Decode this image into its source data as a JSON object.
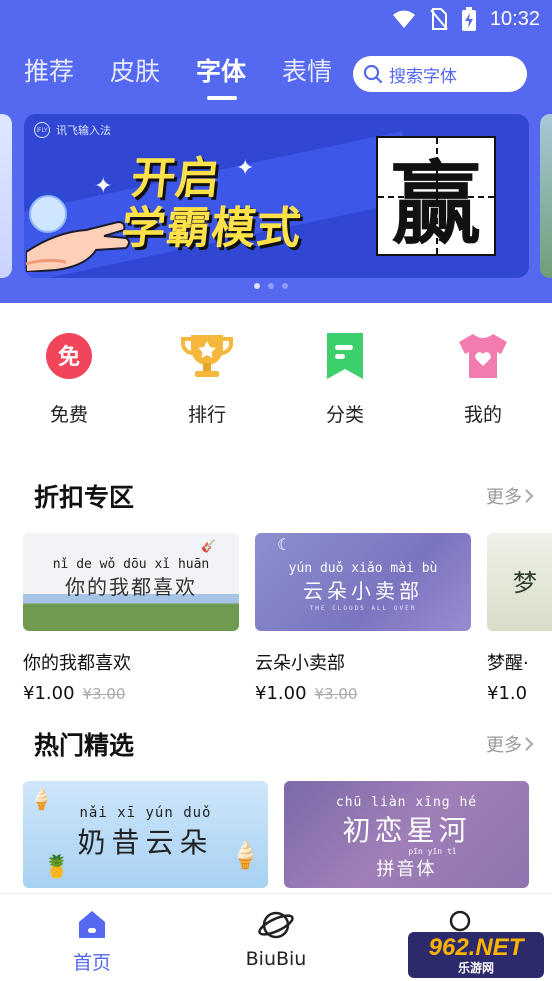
{
  "status": {
    "time": "10:32",
    "icons": [
      "wifi-icon",
      "no-sim-icon",
      "battery-charging-icon"
    ]
  },
  "tabs": [
    {
      "label": "推荐"
    },
    {
      "label": "皮肤"
    },
    {
      "label": "字体",
      "active": true
    },
    {
      "label": "表情"
    }
  ],
  "search": {
    "placeholder": "搜索字体"
  },
  "banner": {
    "brand": "讯飞输入法",
    "brand_logo": "iFLY",
    "line1": "开启",
    "line2": "学霸模式",
    "character": "赢",
    "page_count": 3,
    "active_page": 1
  },
  "shortcuts": [
    {
      "label": "免费",
      "icon": "free-badge-icon",
      "badge": "免",
      "color": "#f0455a"
    },
    {
      "label": "排行",
      "icon": "trophy-icon",
      "color": "#f5b83c"
    },
    {
      "label": "分类",
      "icon": "bookmark-icon",
      "color": "#3ccf6b"
    },
    {
      "label": "我的",
      "icon": "tshirt-heart-icon",
      "color": "#f27bb0"
    }
  ],
  "discount": {
    "title": "折扣专区",
    "more": "更多",
    "items": [
      {
        "name": "你的我都喜欢",
        "price": "¥1.00",
        "original": "¥3.00",
        "preview_pinyin": "nǐ de wǒ dōu xǐ huān",
        "preview_text": "你的我都喜欢"
      },
      {
        "name": "云朵小卖部",
        "price": "¥1.00",
        "original": "¥3.00",
        "preview_pinyin": "yún duǒ xiǎo mài bù",
        "preview_text": "云朵小卖部",
        "preview_sub": "THE CLOUDS ALL OVER"
      },
      {
        "name": "梦醒·",
        "price": "¥1.0",
        "preview_text": "梦"
      }
    ]
  },
  "hot": {
    "title": "热门精选",
    "more": "更多",
    "items": [
      {
        "preview_pinyin": "nǎi xī yún duǒ",
        "preview_text": "奶昔云朵"
      },
      {
        "preview_pinyin": "chū liàn xīng hé",
        "preview_text": "初恋星河",
        "preview_sub_pinyin": "pīn yīn tǐ",
        "preview_sub": "拼音体"
      }
    ]
  },
  "bottom_nav": [
    {
      "label": "首页",
      "icon": "home-icon",
      "active": true
    },
    {
      "label": "BiuBiu",
      "icon": "planet-icon"
    },
    {
      "label": "",
      "icon": "profile-icon"
    }
  ],
  "watermark": {
    "line1": "962.NET",
    "line2": "乐游网"
  },
  "colors": {
    "brand": "#5468f0",
    "text": "#222222",
    "muted": "#999999"
  }
}
